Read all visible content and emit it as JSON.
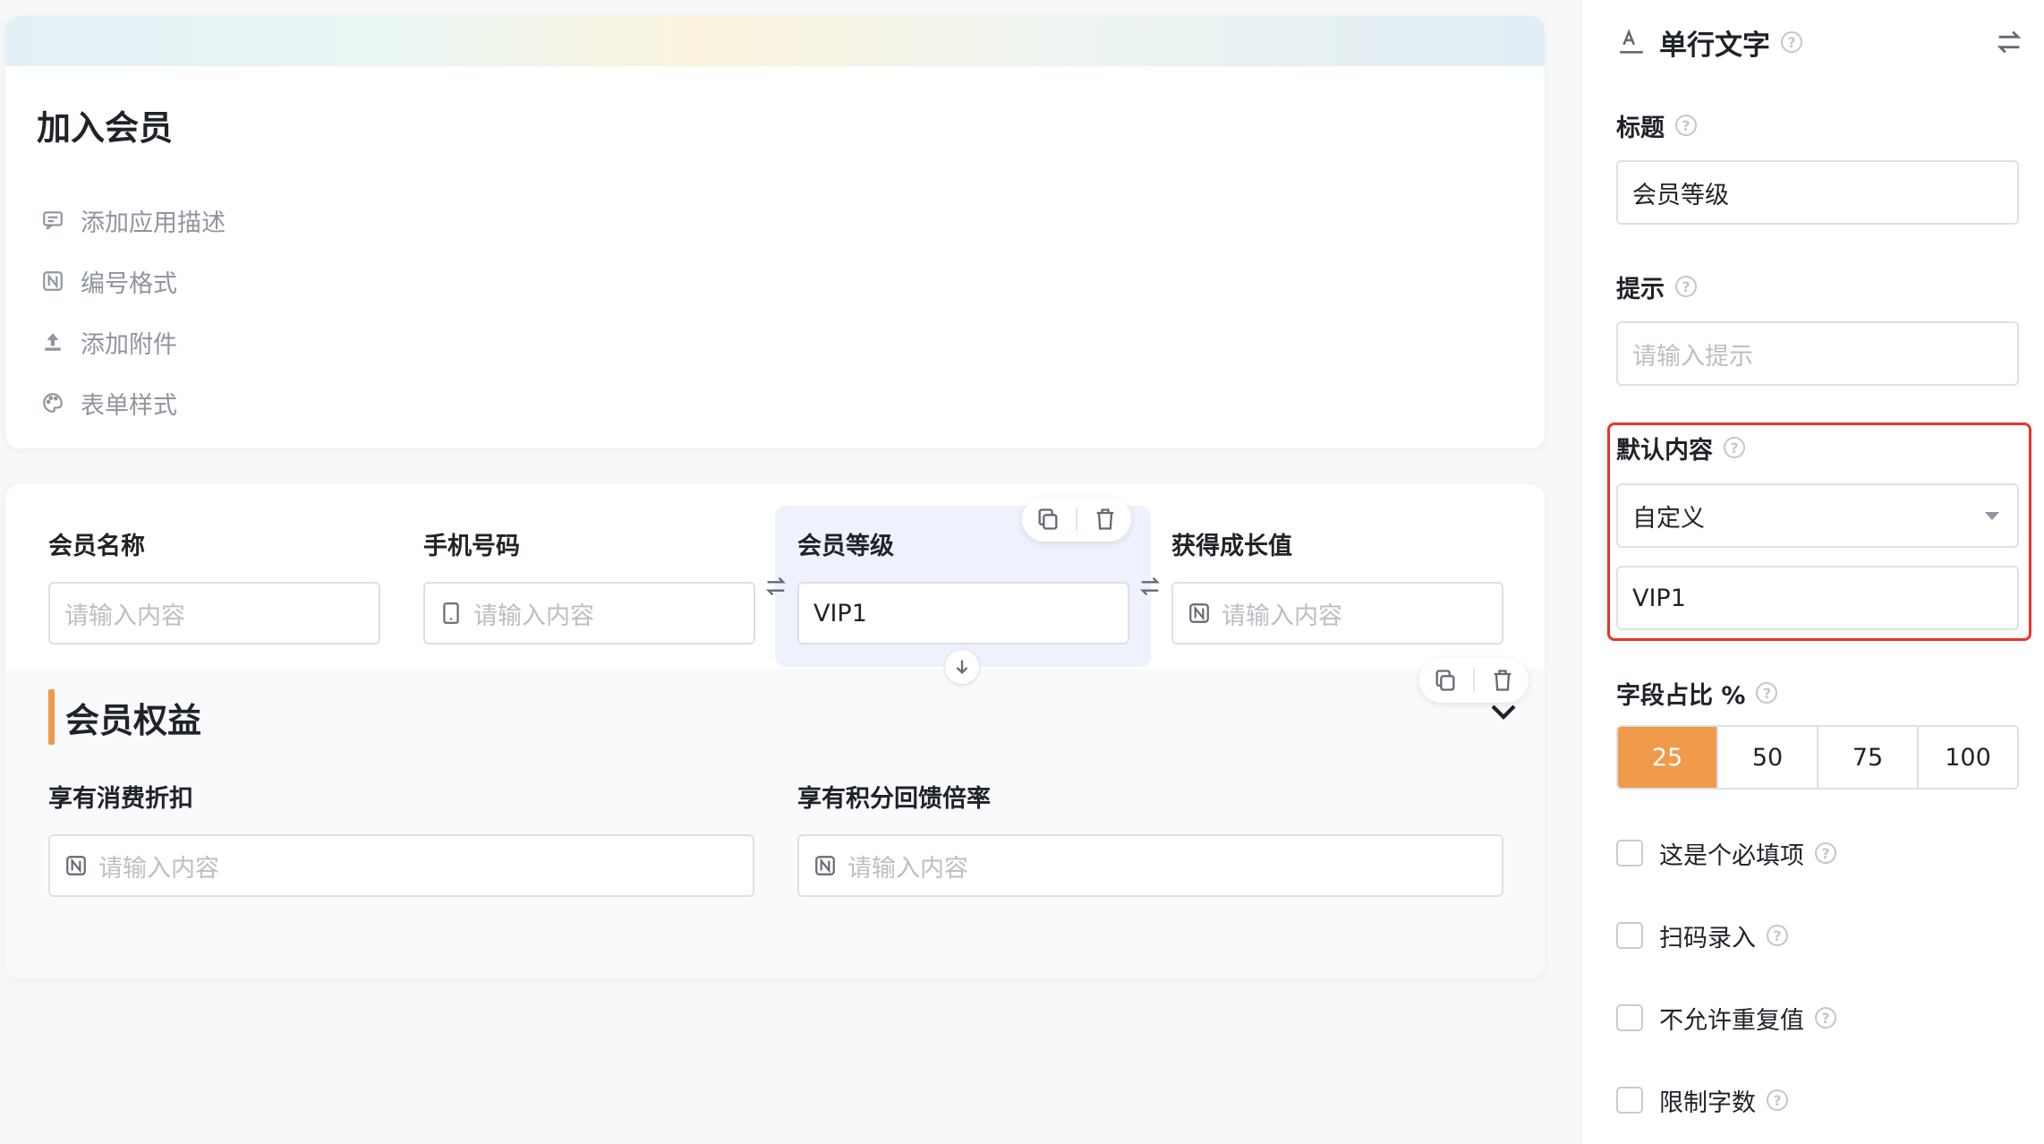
{
  "app": {
    "title": "加入会员",
    "meta_actions": [
      {
        "label": "添加应用描述",
        "icon": "comment-icon"
      },
      {
        "label": "编号格式",
        "icon": "numbering-icon"
      },
      {
        "label": "添加附件",
        "icon": "upload-icon"
      },
      {
        "label": "表单样式",
        "icon": "palette-icon"
      }
    ]
  },
  "form": {
    "fields": [
      {
        "label": "会员名称",
        "placeholder": "请输入内容",
        "value": ""
      },
      {
        "label": "手机号码",
        "placeholder": "请输入内容",
        "value": "",
        "icon": "phone-icon"
      },
      {
        "label": "会员等级",
        "placeholder": "",
        "value": "VIP1",
        "selected": true
      },
      {
        "label": "获得成长值",
        "placeholder": "请输入内容",
        "value": "",
        "icon": "number-icon"
      }
    ],
    "section": {
      "title": "会员权益",
      "fields": [
        {
          "label": "享有消费折扣",
          "placeholder": "请输入内容",
          "icon": "number-icon"
        },
        {
          "label": "享有积分回馈倍率",
          "placeholder": "请输入内容",
          "icon": "number-icon"
        }
      ]
    }
  },
  "panel": {
    "field_type": "单行文字",
    "title_label": "标题",
    "title_value": "会员等级",
    "hint_label": "提示",
    "hint_placeholder": "请输入提示",
    "default_label": "默认内容",
    "default_mode": "自定义",
    "default_value": "VIP1",
    "width_label": "字段占比 %",
    "width_options": [
      "25",
      "50",
      "75",
      "100"
    ],
    "width_selected": "25",
    "checks": [
      {
        "label": "这是个必填项",
        "checked": false
      },
      {
        "label": "扫码录入",
        "checked": false
      },
      {
        "label": "不允许重复值",
        "checked": false
      },
      {
        "label": "限制字数",
        "checked": false
      }
    ],
    "help_glyph": "?"
  },
  "colors": {
    "accent_orange": "#f09a4b",
    "highlight_red": "#e8352a",
    "selected_bg": "#eef2fc"
  }
}
